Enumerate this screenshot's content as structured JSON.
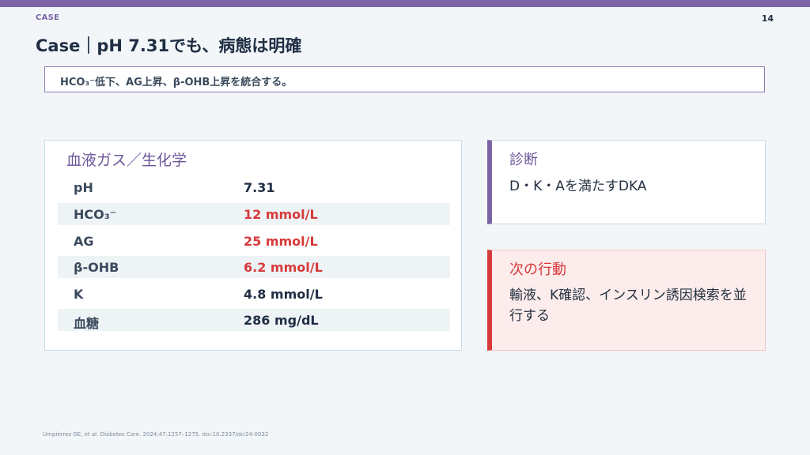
{
  "header": {
    "kicker": "CASE",
    "page_number": "14",
    "title": "Case｜pH 7.31でも、病態は明確"
  },
  "callout": {
    "text": "HCO₃⁻低下、AG上昇、β-OHB上昇を統合する。"
  },
  "labs": {
    "title": "血液ガス／生化学",
    "rows": [
      {
        "name": "pH",
        "value": "7.31",
        "color": "#1f2e44"
      },
      {
        "name": "HCO₃⁻",
        "value": "12 mmol/L",
        "color": "#d63a3a"
      },
      {
        "name": "AG",
        "value": "25 mmol/L",
        "color": "#d63a3a"
      },
      {
        "name": "β-OHB",
        "value": "6.2 mmol/L",
        "color": "#d63a3a"
      },
      {
        "name": "K",
        "value": "4.8 mmol/L",
        "color": "#1f2e44"
      },
      {
        "name": "血糖",
        "value": "286 mg/dL",
        "color": "#1f2e44"
      }
    ]
  },
  "diagnosis": {
    "title": "診断",
    "text": "D・K・Aを満たすDKA",
    "accent": "#7b63a6"
  },
  "next_action": {
    "title": "次の行動",
    "text": "輸液、K確認、インスリン誘因検索を並行する",
    "accent": "#d63a3a"
  },
  "footer": {
    "citation": "Umpierrez GE, et al. Diabetes Care. 2024;47:1257–1275. doi:10.2337/dci24-0032"
  }
}
